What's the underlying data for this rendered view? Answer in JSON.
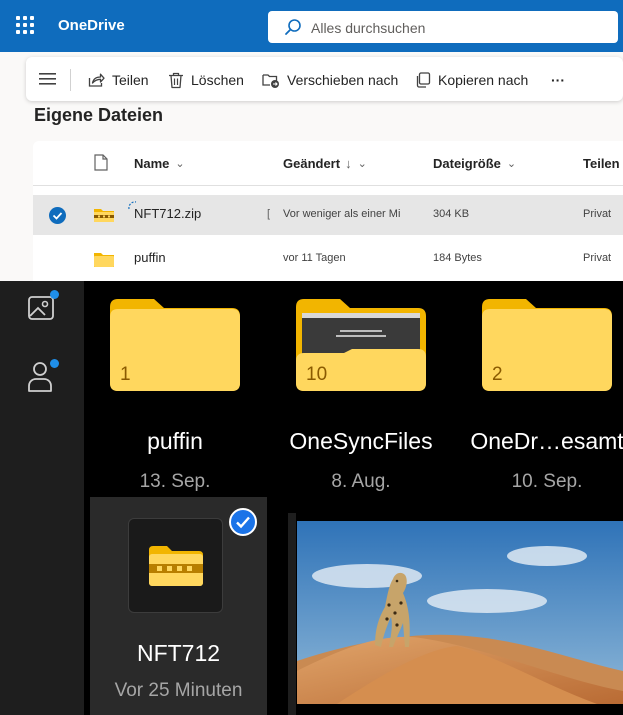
{
  "app": {
    "title": "OneDrive"
  },
  "search": {
    "placeholder": "Alles durchsuchen"
  },
  "commands": {
    "share": "Teilen",
    "delete": "Löschen",
    "move": "Verschieben nach",
    "copy": "Kopieren nach",
    "more": "···"
  },
  "page_title": "Eigene Dateien",
  "table": {
    "headers": {
      "name": "Name",
      "modified": "Geändert",
      "modified_sort": "↓",
      "size": "Dateigröße",
      "sharing": "Teilen"
    },
    "rows": [
      {
        "name": "NFT712.zip",
        "modified": "Vor weniger als einer Mi",
        "size": "304 KB",
        "sharing": "Privat",
        "selected": true,
        "icon": "zip-icon"
      },
      {
        "name": "puffin",
        "modified": "vor 11 Tagen",
        "size": "184 Bytes",
        "sharing": "Privat",
        "selected": false,
        "icon": "folder-icon"
      }
    ]
  },
  "mobile": {
    "folders": [
      {
        "name": "puffin",
        "date": "13. Sep.",
        "count": "1"
      },
      {
        "name": "OneSyncFiles",
        "date": "8. Aug.",
        "count": "10"
      },
      {
        "name": "OneDr…esamt",
        "date": "10. Sep.",
        "count": "2"
      }
    ],
    "zip": {
      "name": "NFT712",
      "date": "Vor 25 Minuten",
      "selected": true
    },
    "photo": {
      "subject": "cheetah-on-dune"
    }
  },
  "colors": {
    "brand_blue": "#0f6cbd",
    "folder_yellow": "#ffd75e",
    "folder_tab": "#f2b500",
    "selected_check": "#1a73e8",
    "notification_dot": "#1f8ee8"
  }
}
